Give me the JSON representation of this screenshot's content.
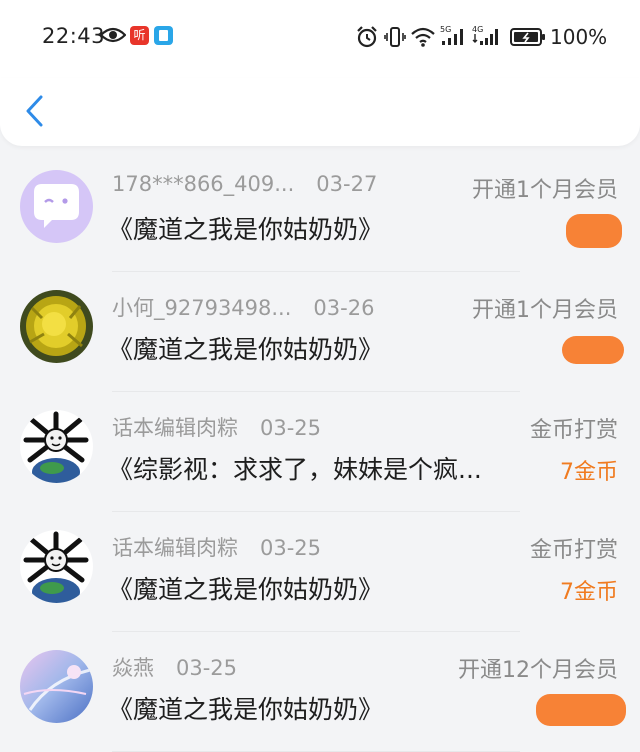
{
  "status_bar": {
    "time": "22:43",
    "app_badge_text": "听",
    "battery": "100%",
    "icons": [
      "eye-icon",
      "ting-app-icon",
      "book-app-icon",
      "alarm-icon",
      "vibrate-icon",
      "wifi-icon",
      "signal-5g-icon",
      "signal-4g-icon",
      "battery-icon"
    ],
    "network1": "5G",
    "network2": "4G"
  },
  "nav": {
    "back_icon": "chevron-left-icon",
    "accent": "#2e8be8"
  },
  "records": [
    {
      "user": "178***866_409...",
      "date": "03-27",
      "title": "《魔道之我是你姑奶奶》",
      "type": "开通1个月会员",
      "amount": ""
    },
    {
      "user": "小何_92793498...",
      "date": "03-26",
      "title": "《魔道之我是你姑奶奶》",
      "type": "开通1个月会员",
      "amount": ""
    },
    {
      "user": "话本编辑肉粽",
      "date": "03-25",
      "title": "《综影视：求求了，妹妹是个疯...",
      "type": "金币打赏",
      "amount": "7金币"
    },
    {
      "user": "话本编辑肉粽",
      "date": "03-25",
      "title": "《魔道之我是你姑奶奶》",
      "type": "金币打赏",
      "amount": "7金币"
    },
    {
      "user": "焱燕",
      "date": "03-25",
      "title": "《魔道之我是你姑奶奶》",
      "type": "开通12个月会员",
      "amount": ""
    }
  ],
  "colors": {
    "amount": "#f07b20",
    "redaction": "#f78236",
    "secondary_text": "#9b9b9b"
  }
}
